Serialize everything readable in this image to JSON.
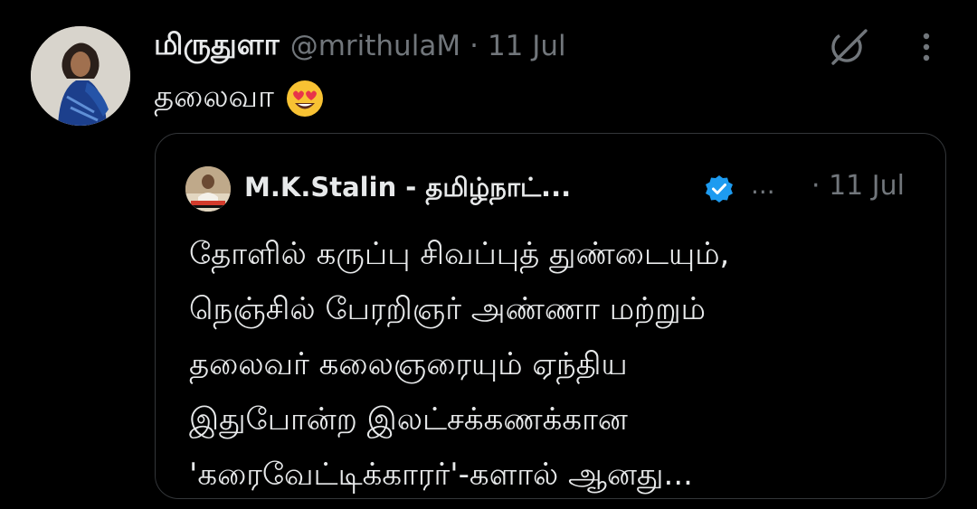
{
  "tweet": {
    "author": {
      "display_name": "மிருதுளா",
      "handle": "@mrithulaM"
    },
    "separator": "·",
    "time": "11 Jul",
    "text": "தலைவா",
    "emoji": "heart-eyes-emoji"
  },
  "quote": {
    "author": {
      "display_name": "M.K.Stalin - தமிழ்நாட்...",
      "verified": true
    },
    "ellipsis": "...",
    "time": "· 11 Jul",
    "lines": [
      "தோளில் கருப்பு சிவப்புத் துண்டையும்,",
      "நெஞ்சில் பேரறிஞர் அண்ணா மற்றும்",
      "தலைவர் கலைஞரையும் ஏந்திய",
      "இதுபோன்ற இலட்சக்கணக்கான",
      "'கரைவேட்டிக்காரர்'-களால் ஆனது..."
    ]
  },
  "icons": {
    "grok": "grok-icon",
    "more": "more-vertical-icon",
    "verified": "verified-badge-icon"
  },
  "colors": {
    "background": "#000000",
    "text_primary": "#e7e9ea",
    "text_secondary": "#71767b",
    "border": "#333639",
    "verified_blue": "#1d9bf0"
  }
}
